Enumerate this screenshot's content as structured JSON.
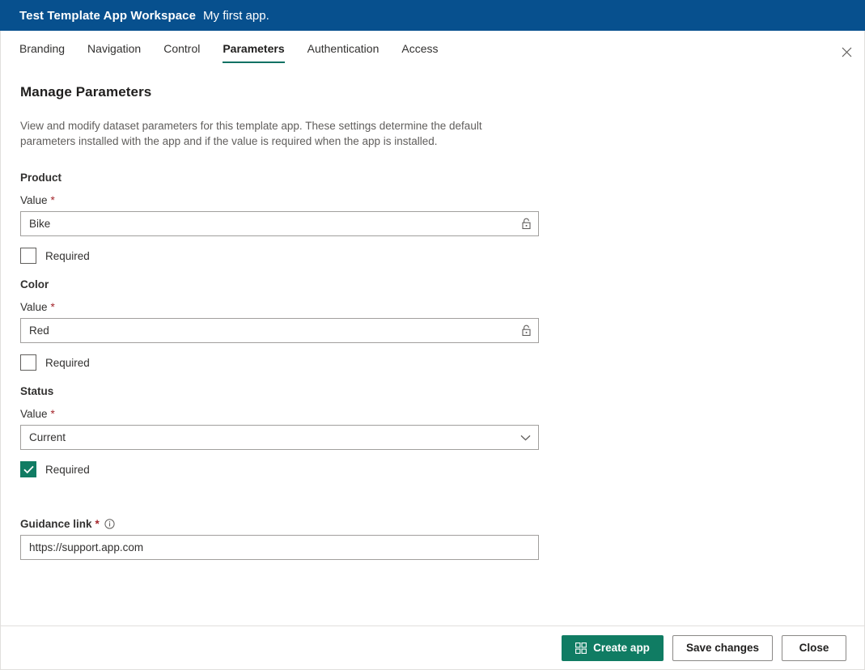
{
  "header": {
    "workspace_title": "Test Template App Workspace",
    "app_name": "My first app.",
    "background_color": "#07508E",
    "close_icon": "close-icon"
  },
  "tabs": {
    "items": [
      {
        "label": "Branding",
        "selected": false
      },
      {
        "label": "Navigation",
        "selected": false
      },
      {
        "label": "Control",
        "selected": false
      },
      {
        "label": "Parameters",
        "selected": true
      },
      {
        "label": "Authentication",
        "selected": false
      },
      {
        "label": "Access",
        "selected": false
      }
    ],
    "accent_color": "#0E7264"
  },
  "main": {
    "title": "Manage Parameters",
    "description": "View and modify dataset parameters for this template app. These settings determine the default parameters installed with the app and if the value is required when the app is installed.",
    "required_marker": "*",
    "value_label": "Value",
    "required_checkbox_label": "Required",
    "parameters": [
      {
        "name": "Product",
        "value": "Bike",
        "control": "text",
        "affix_icon": "lock-icon",
        "required_checked": false
      },
      {
        "name": "Color",
        "value": "Red",
        "control": "text",
        "affix_icon": "lock-icon",
        "required_checked": false
      },
      {
        "name": "Status",
        "value": "Current",
        "control": "dropdown",
        "affix_icon": "chevron-down-icon",
        "required_checked": true
      }
    ],
    "guidance": {
      "label": "Guidance link",
      "required_marker": "*",
      "info_icon": "info-icon",
      "value": "https://support.app.com"
    }
  },
  "footer": {
    "create_app_label": "Create app",
    "create_app_icon": "apps-grid-icon",
    "save_changes_label": "Save changes",
    "close_label": "Close",
    "primary_color": "#107C63"
  }
}
